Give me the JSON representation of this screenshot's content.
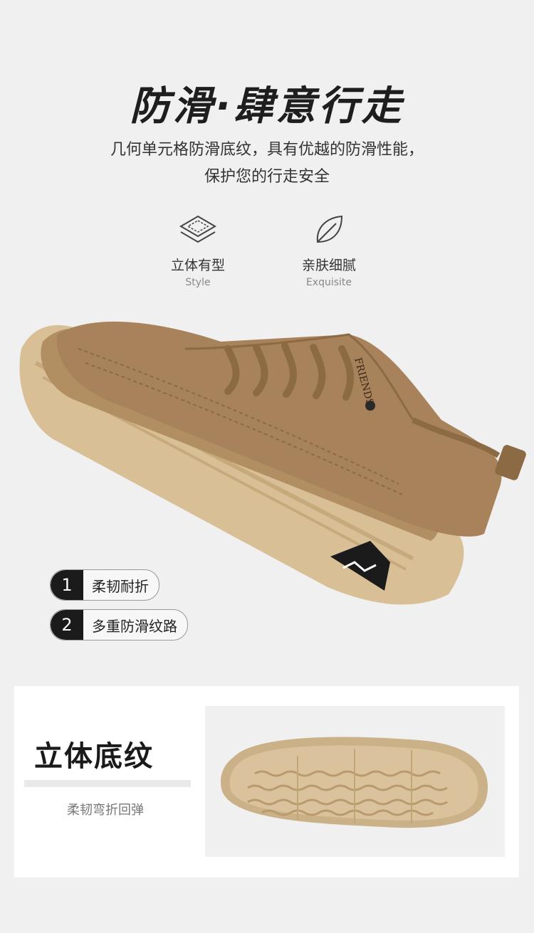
{
  "hero": {
    "title": "防滑·肆意行走",
    "desc_line1": "几何单元格防滑底纹，具有优越的防滑性能，",
    "desc_line2": "保护您的行走安全"
  },
  "features": [
    {
      "icon": "layers-icon",
      "cn": "立体有型",
      "en": "Style"
    },
    {
      "icon": "leaf-icon",
      "cn": "亲肤细腻",
      "en": "Exquisite"
    }
  ],
  "badges": [
    {
      "num": "1",
      "text": "柔韧耐折"
    },
    {
      "num": "2",
      "text": "多重防滑纹路"
    }
  ],
  "shoe_brand_text": "FRIENDS",
  "panel": {
    "title": "立体底纹",
    "subtitle": "柔韧弯折回弹"
  },
  "colors": {
    "leather": "#a8825a",
    "sole": "#d8bf95",
    "dark": "#1b1b1b"
  }
}
